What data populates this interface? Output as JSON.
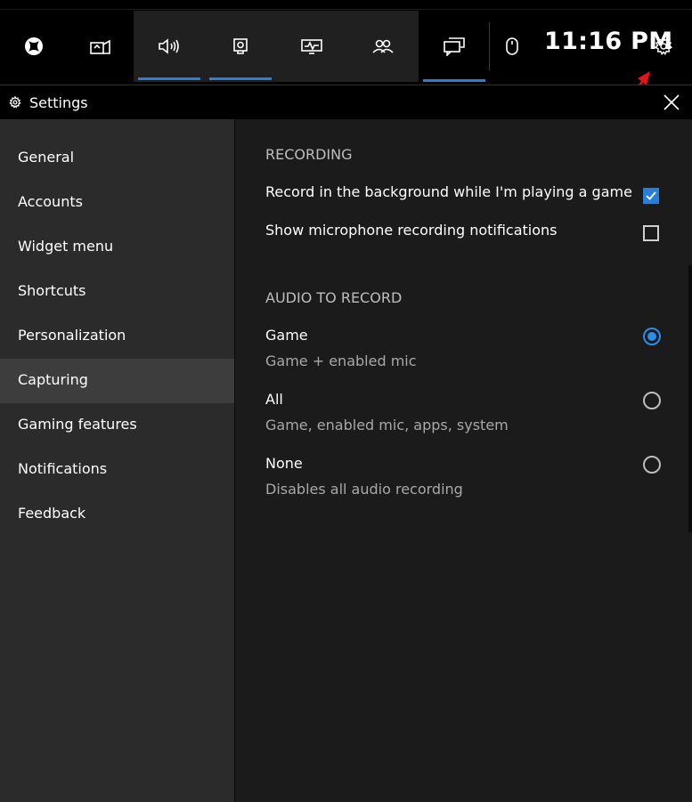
{
  "gamebar": {
    "time": "11:16 PM",
    "buttons": [
      "xbox-icon",
      "performance-icon",
      "audio-icon",
      "capture-icon",
      "resources-icon",
      "social-icon",
      "chat-icon",
      "mouse-icon",
      "settings-icon"
    ],
    "accent": "#2a7fd4"
  },
  "settings": {
    "title": "Settings",
    "nav": [
      {
        "label": "General"
      },
      {
        "label": "Accounts"
      },
      {
        "label": "Widget menu"
      },
      {
        "label": "Shortcuts"
      },
      {
        "label": "Personalization"
      },
      {
        "label": "Capturing",
        "active": true
      },
      {
        "label": "Gaming features"
      },
      {
        "label": "Notifications"
      },
      {
        "label": "Feedback"
      }
    ],
    "recording": {
      "heading": "RECORDING",
      "background_label": "Record in the background while I'm playing a game",
      "background_checked": true,
      "mic_label": "Show microphone recording notifications",
      "mic_checked": false
    },
    "audio": {
      "heading": "AUDIO TO RECORD",
      "options": [
        {
          "label": "Game",
          "desc": "Game + enabled mic",
          "selected": true
        },
        {
          "label": "All",
          "desc": "Game, enabled mic, apps, system",
          "selected": false
        },
        {
          "label": "None",
          "desc": "Disables all audio recording",
          "selected": false
        }
      ]
    }
  }
}
